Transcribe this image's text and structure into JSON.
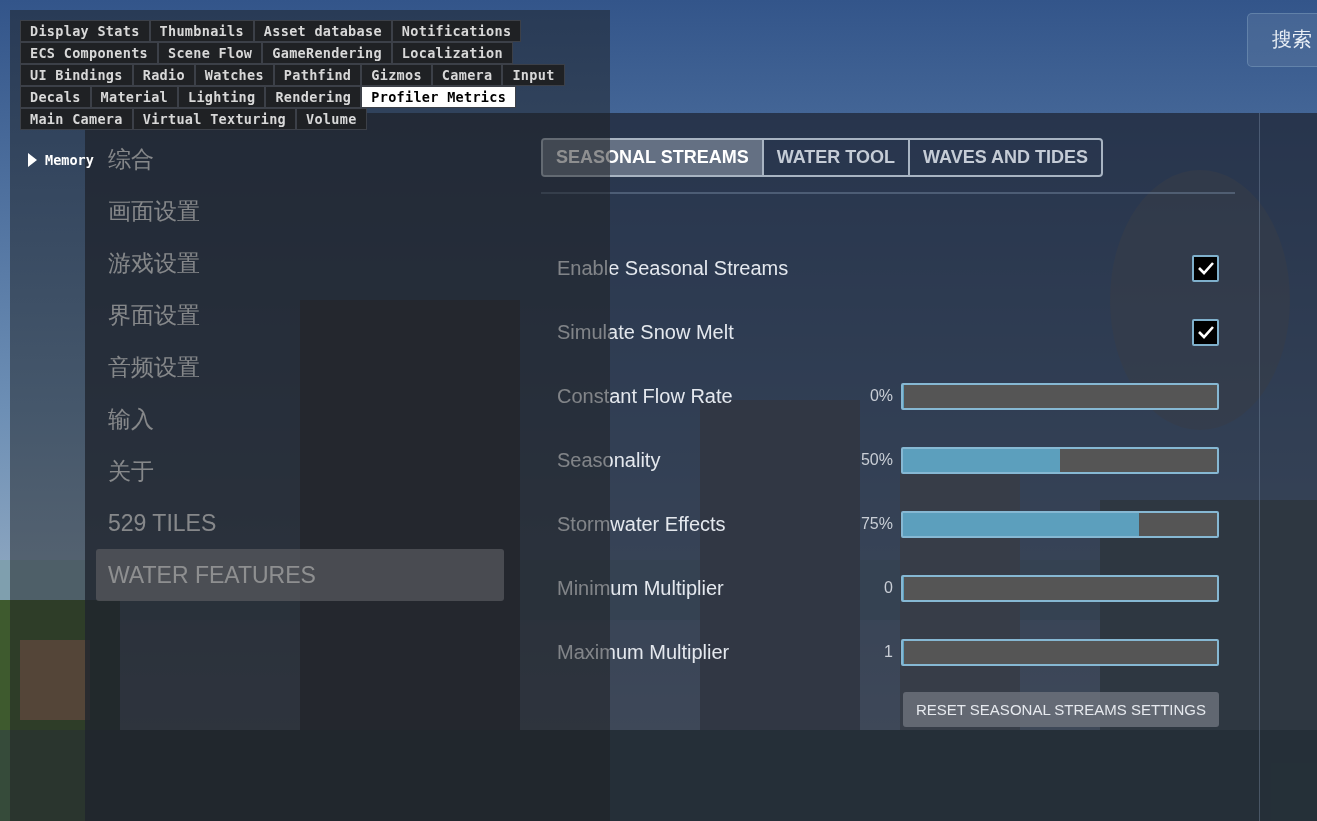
{
  "debug_panel": {
    "tab_rows": [
      [
        {
          "label": "Display Stats",
          "selected": false
        },
        {
          "label": "Thumbnails",
          "selected": false
        },
        {
          "label": "Asset database",
          "selected": false
        },
        {
          "label": "Notifications",
          "selected": false
        }
      ],
      [
        {
          "label": "ECS Components",
          "selected": false
        },
        {
          "label": "Scene Flow",
          "selected": false
        },
        {
          "label": "GameRendering",
          "selected": false
        },
        {
          "label": "Localization",
          "selected": false
        }
      ],
      [
        {
          "label": "UI Bindings",
          "selected": false
        },
        {
          "label": "Radio",
          "selected": false
        },
        {
          "label": "Watches",
          "selected": false
        },
        {
          "label": "Pathfind",
          "selected": false
        },
        {
          "label": "Gizmos",
          "selected": false
        },
        {
          "label": "Camera",
          "selected": false
        },
        {
          "label": "Input",
          "selected": false
        }
      ],
      [
        {
          "label": "Decals",
          "selected": false
        },
        {
          "label": "Material",
          "selected": false
        },
        {
          "label": "Lighting",
          "selected": false
        },
        {
          "label": "Rendering",
          "selected": false
        },
        {
          "label": "Profiler Metrics",
          "selected": true
        }
      ],
      [
        {
          "label": "Main Camera",
          "selected": false
        },
        {
          "label": "Virtual Texturing",
          "selected": false
        },
        {
          "label": "Volume",
          "selected": false
        }
      ]
    ],
    "tree": [
      {
        "label": "Memory",
        "expanded": false
      }
    ]
  },
  "search_button": {
    "label": "搜索"
  },
  "sidebar": {
    "items": [
      {
        "label": "综合",
        "selected": false
      },
      {
        "label": "画面设置",
        "selected": false
      },
      {
        "label": "游戏设置",
        "selected": false
      },
      {
        "label": "界面设置",
        "selected": false
      },
      {
        "label": "音频设置",
        "selected": false
      },
      {
        "label": "输入",
        "selected": false
      },
      {
        "label": "关于",
        "selected": false
      },
      {
        "label": "529 TILES",
        "selected": false
      },
      {
        "label": "WATER FEATURES",
        "selected": true
      }
    ]
  },
  "tabs": [
    {
      "label": "SEASONAL STREAMS",
      "selected": true
    },
    {
      "label": "WATER TOOL",
      "selected": false
    },
    {
      "label": "WAVES AND TIDES",
      "selected": false
    }
  ],
  "settings": [
    {
      "kind": "checkbox",
      "label": "Enable Seasonal Streams",
      "checked": true
    },
    {
      "kind": "checkbox",
      "label": "Simulate Snow Melt",
      "checked": true
    },
    {
      "kind": "slider",
      "label": "Constant Flow Rate",
      "reading": "0%",
      "level": 0
    },
    {
      "kind": "slider",
      "label": "Seasonality",
      "reading": "50%",
      "level": 0.5
    },
    {
      "kind": "slider",
      "label": "Stormwater Effects",
      "reading": "75%",
      "level": 0.75
    },
    {
      "kind": "slider",
      "label": "Minimum Multiplier",
      "reading": "0",
      "level": 0
    },
    {
      "kind": "slider",
      "label": "Maximum Multiplier",
      "reading": "1",
      "level": 0
    }
  ],
  "reset_button": {
    "label": "RESET SEASONAL STREAMS SETTINGS"
  }
}
